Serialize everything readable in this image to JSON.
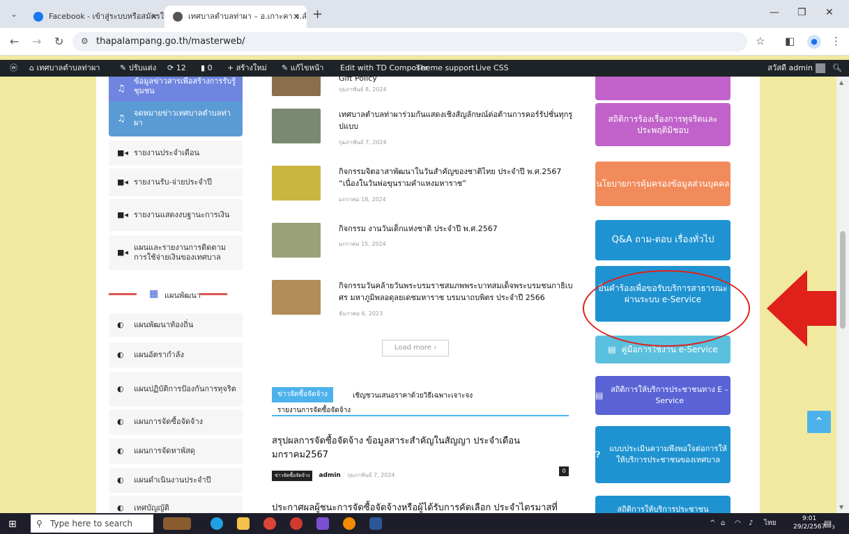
{
  "browser": {
    "tabs": [
      {
        "title": "Facebook - เข้าสู่ระบบหรือสมัครใช้",
        "active": false
      },
      {
        "title": "เทศบาลตำบลท่าผา – อ.เกาะคา จ.ลำ",
        "active": true
      }
    ],
    "url": "thapalampang.go.th/masterweb/"
  },
  "adminbar": {
    "site_name": "เทศบาลตำบลท่าผา",
    "customize": "ปรับแต่ง",
    "updates": "12",
    "comments": "0",
    "new": "สร้างใหม่",
    "edit_page": "แก้ไขหน้า",
    "td_composer": "Edit with TD Composer",
    "theme_support": "Theme support",
    "live_css": "Live CSS",
    "greeting": "สวัสดี admin"
  },
  "sidebar": {
    "top_button_1": "ข้อมูลข่าวสารเพื่อสร้างการรับรู้ชุมชน",
    "top_button_2": "จดหมายข่าวเทศบาลตำบลท่าผา",
    "reports": [
      "รายงานประจำเดือน",
      "รายงานรับ-จ่ายประจำปี",
      "รายงานแสดงงบฐานะการเงิน",
      "แผนและรายงานการติดตามการใช้จ่ายเงินของเทศบาล"
    ],
    "plan_heading": "แผนพัฒนา",
    "plans": [
      "แผนพัฒนาท้องถิ่น",
      "แผนอัตรากำลัง",
      "แผนปฏิบัติการป้องกันการทุจริต",
      "แผนการจัดซื้อจัดจ้าง",
      "แผนการจัดหาพัสดุ",
      "แผนดำเนินงานประจำปี",
      "เทศบัญญัติ"
    ]
  },
  "news": [
    {
      "title": "Gift Policy",
      "date": "กุมภาพันธ์ 8, 2024"
    },
    {
      "title": "เทศบาลตำบลท่าผาร่วมกันแสดงเชิงสัญลักษณ์ต่อต้านการคอร์รัปชั่นทุกรูปแบบ",
      "date": "กุมภาพันธ์ 7, 2024"
    },
    {
      "title": "กิจกรรมจิตอาสาพัฒนาในวันสำคัญของชาติไทย ประจำปี พ.ศ.2567 “เนื่องในวันพ่อขุนรามคำแหงมหาราช”",
      "date": "มกราคม 18, 2024"
    },
    {
      "title": "กิจกรรม งานวันเด็กแห่งชาติ ประจำปี พ.ศ.2567",
      "date": "มกราคม 15, 2024"
    },
    {
      "title": "กิจกรรมวันคล้ายวันพระบรมราชสมภพพระบาทสมเด็จพระบรมชนกาธิเบศร มหาภูมิพลอดุลยเดชมหาราช บรมนาถบพิตร ประจำปี 2566",
      "date": "ธันวาคม 6, 2023"
    }
  ],
  "load_more": "Load more",
  "procurement": {
    "active_tab": "ข่าวจัดซื้อจัดจ้าง",
    "tab_2": "เชิญชวนเสนอราคาด้วยวิธีเฉพาะเจาะจง",
    "tab_3": "รายงานการจัดซื้อจัดจ้าง",
    "article_1": {
      "title": "สรุปผลการจัดซื้อจัดจ้าง ข้อมูลสาระสำคัญในสัญญา ประจำเดือน มกราคม2567",
      "category": "ข่าวจัดซื้อจัดจ้าง",
      "author": "admin",
      "date": "กุมภาพันธ์ 7, 2024",
      "comments": "0"
    },
    "article_2": {
      "title": "ประกาศผลผู้ชนะการจัดซื้อจัดจ้างหรือผู้ได้รับการคัดเลือก ประจำไตรมาสที่"
    }
  },
  "right_buttons": [
    {
      "label": "",
      "color": "#c062c9"
    },
    {
      "label": "สถิติการร้องเรื่องการทุจริตและประพฤติมิชอบ",
      "color": "#c062c9"
    },
    {
      "label": "นโยบายการคุ้มครองข้อมูลส่วนบุคคล",
      "color": "#f28b5c"
    },
    {
      "label": "Q&A ถาม-ตอบ เรื่องทั่วไป",
      "color": "#1f93d1"
    },
    {
      "label": "ยื่นคำร้องเพื่อขอรับบริการสาธารณะผ่านระบบ e-Service",
      "color": "#1f93d1"
    },
    {
      "label": "คู่มือการใช้งาน e-Service",
      "color": "#5bc0de"
    },
    {
      "label": "สถิติการให้บริการประชาชนทาง E – Service",
      "color": "#5a63d6"
    },
    {
      "label": "แบบประเมินความพึงพอใจต่อการให้ให้บริการประชาชนของเทศบาล",
      "color": "#1f93d1"
    },
    {
      "label": "สถิติการให้บริการประชาชน",
      "color": "#1f93d1"
    }
  ],
  "taskbar": {
    "search_placeholder": "Type here to search",
    "language": "ไทย",
    "time": "9:01",
    "date": "29/2/2567",
    "notifications": "3"
  }
}
